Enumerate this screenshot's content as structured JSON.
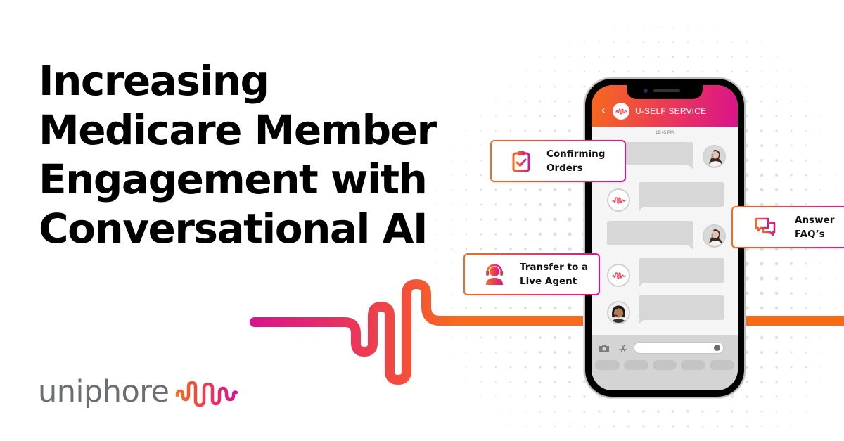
{
  "headline": {
    "lines": [
      "Increasing",
      "Medicare Member",
      "Engagement with",
      "Conversational AI"
    ]
  },
  "brand": {
    "name": "uniphore",
    "colors": {
      "gradient_start": "#f76b1c",
      "gradient_mid": "#ec3a55",
      "gradient_end": "#d9138c",
      "text_gray": "#6d6e71"
    }
  },
  "phone": {
    "header": {
      "back_icon": "chevron-left-icon",
      "title": "U-SELF SERVICE"
    },
    "timestamp": "12:45 PM",
    "messages": [
      {
        "from": "user",
        "avatar": "woman-on-phone"
      },
      {
        "from": "bot",
        "avatar": "uniphore-wave"
      },
      {
        "from": "user",
        "avatar": "woman-on-phone"
      },
      {
        "from": "bot",
        "avatar": "uniphore-wave"
      },
      {
        "from": "agent",
        "avatar": "agent-with-headset"
      }
    ],
    "input": {
      "camera_icon": "camera-icon",
      "apps_icon": "app-store-icon",
      "value": ""
    }
  },
  "cards": [
    {
      "id": "confirming-orders",
      "icon": "clipboard-check-icon",
      "label": "Confirming\nOrders"
    },
    {
      "id": "answer-faqs",
      "icon": "chat-bubbles-icon",
      "label": "Answer\nFAQ’s"
    },
    {
      "id": "transfer-live-agent",
      "icon": "headset-agent-icon",
      "label": "Transfer to a\nLive Agent"
    }
  ]
}
